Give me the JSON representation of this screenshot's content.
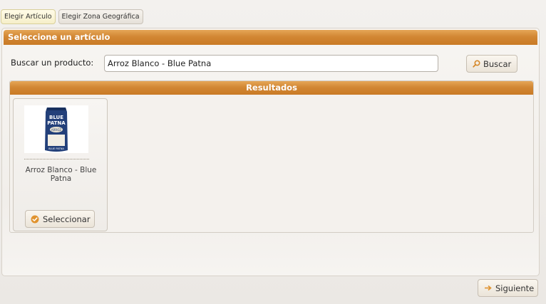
{
  "tabs": [
    {
      "label": "Elegir Artículo",
      "active": true
    },
    {
      "label": "Elegir Zona Geográfica",
      "active": false
    }
  ],
  "panel": {
    "title": "Seleccione un artículo"
  },
  "search": {
    "label": "Buscar un producto:",
    "value": "Arroz Blanco - Blue Patna",
    "button_label": "Buscar",
    "button_icon": "search-icon"
  },
  "results": {
    "title": "Resultados",
    "items": [
      {
        "name": "Arroz Blanco - Blue Patna",
        "image_icon": "rice-bag-image",
        "image_text": {
          "brand_line1": "BLUE",
          "brand_line2": "PATNA",
          "sub": "ARROZ",
          "bottom": "BLUE PATNA"
        },
        "select_label": "Seleccionar",
        "select_icon": "check-circle-icon"
      }
    ]
  },
  "footer": {
    "next_label": "Siguiente",
    "next_icon": "arrow-right-icon"
  },
  "colors": {
    "header_orange": "#d28734",
    "accent_orange": "#e0932f",
    "bag_blue": "#23407a"
  }
}
